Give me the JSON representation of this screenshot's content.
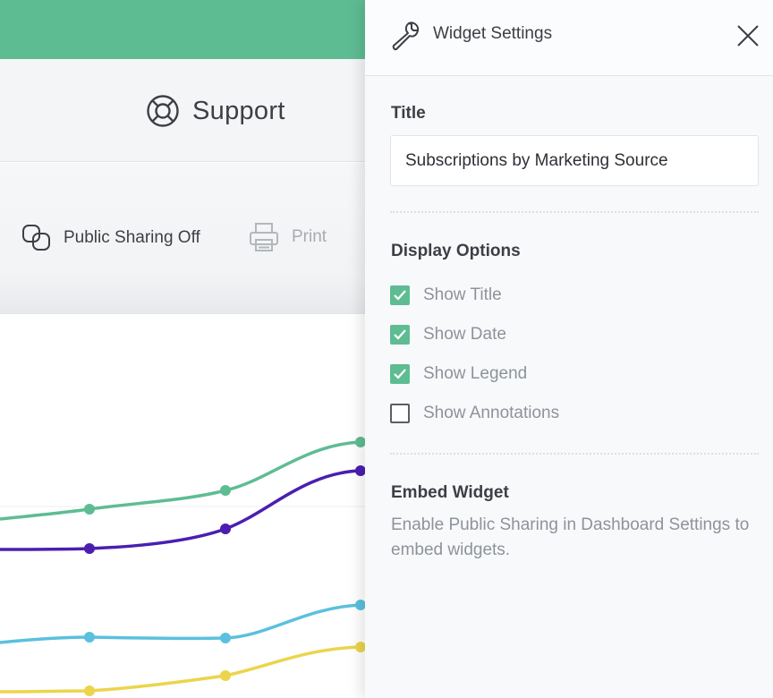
{
  "support": {
    "label": "Support",
    "icon": "lifebuoy-icon"
  },
  "toolbar": {
    "public_sharing_label": "Public Sharing Off",
    "public_sharing_icon": "link-icon",
    "print_label": "Print",
    "print_icon": "printer-icon"
  },
  "colors": {
    "brand": "#5ebc93",
    "series_green": "#5ebc93",
    "series_purple": "#4a1faf",
    "series_blue": "#5bc0de",
    "series_yellow": "#ecd44c"
  },
  "panel": {
    "title": "Widget Settings",
    "icon": "wrench-icon",
    "close_icon": "close-icon",
    "title_section_label": "Title",
    "title_value": "Subscriptions by Marketing Source",
    "display_options_label": "Display Options",
    "options": [
      {
        "label": "Show Title",
        "checked": true
      },
      {
        "label": "Show Date",
        "checked": true
      },
      {
        "label": "Show Legend",
        "checked": true
      },
      {
        "label": "Show Annotations",
        "checked": false
      }
    ],
    "embed_label": "Embed Widget",
    "embed_text": "Enable Public Sharing in Dashboard Settings to embed widgets."
  }
}
